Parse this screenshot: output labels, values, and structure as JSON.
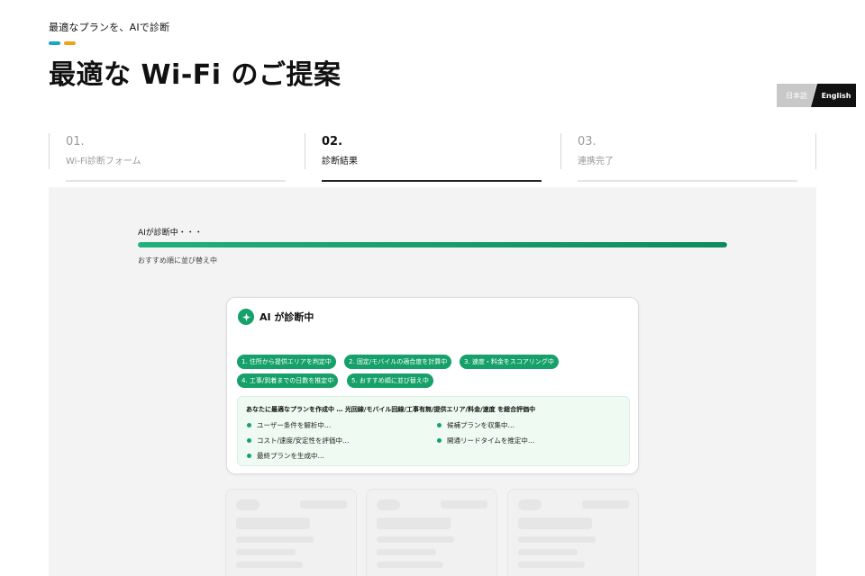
{
  "header": {
    "kicker": "最適なプランを、AIで診断",
    "title": "最適な Wi-Fi のご提案",
    "accent_colors": [
      "#19a7c7",
      "#f0a11b"
    ]
  },
  "language": {
    "japanese_label": "日本語",
    "english_label": "English",
    "selected": "English"
  },
  "steps": [
    {
      "number": "01.",
      "label": "Wi-Fi診断フォーム",
      "active": false
    },
    {
      "number": "02.",
      "label": "診断結果",
      "active": true
    },
    {
      "number": "03.",
      "label": "連携完了",
      "active": false
    }
  ],
  "progress": {
    "label": "AIが診断中・・・",
    "sub": "おすすめ順に並び替え中",
    "percent": 100,
    "color": "#16a06a"
  },
  "ai_card": {
    "title": "AI が診断中",
    "chips": [
      "1. 住所から提供エリアを判定中",
      "2. 固定/モバイルの適合度を計算中",
      "3. 速度・料金をスコアリング中",
      "4. 工事/到着までの日数を推定中",
      "5. おすすめ順に並び替え中"
    ],
    "summary_title": "あなたに最適なプランを作成中 … 光回線/モバイル回線/工事有無/提供エリア/料金/速度 を総合評価中",
    "items_left": [
      "ユーザー条件を解析中…",
      "コスト/速度/安定性を評価中…",
      "最終プランを生成中…"
    ],
    "items_right": [
      "候補プランを収集中…",
      "開通リードタイムを推定中…"
    ]
  },
  "colors": {
    "brand_green": "#16a06a",
    "panel_bg": "#f3f3f3"
  }
}
